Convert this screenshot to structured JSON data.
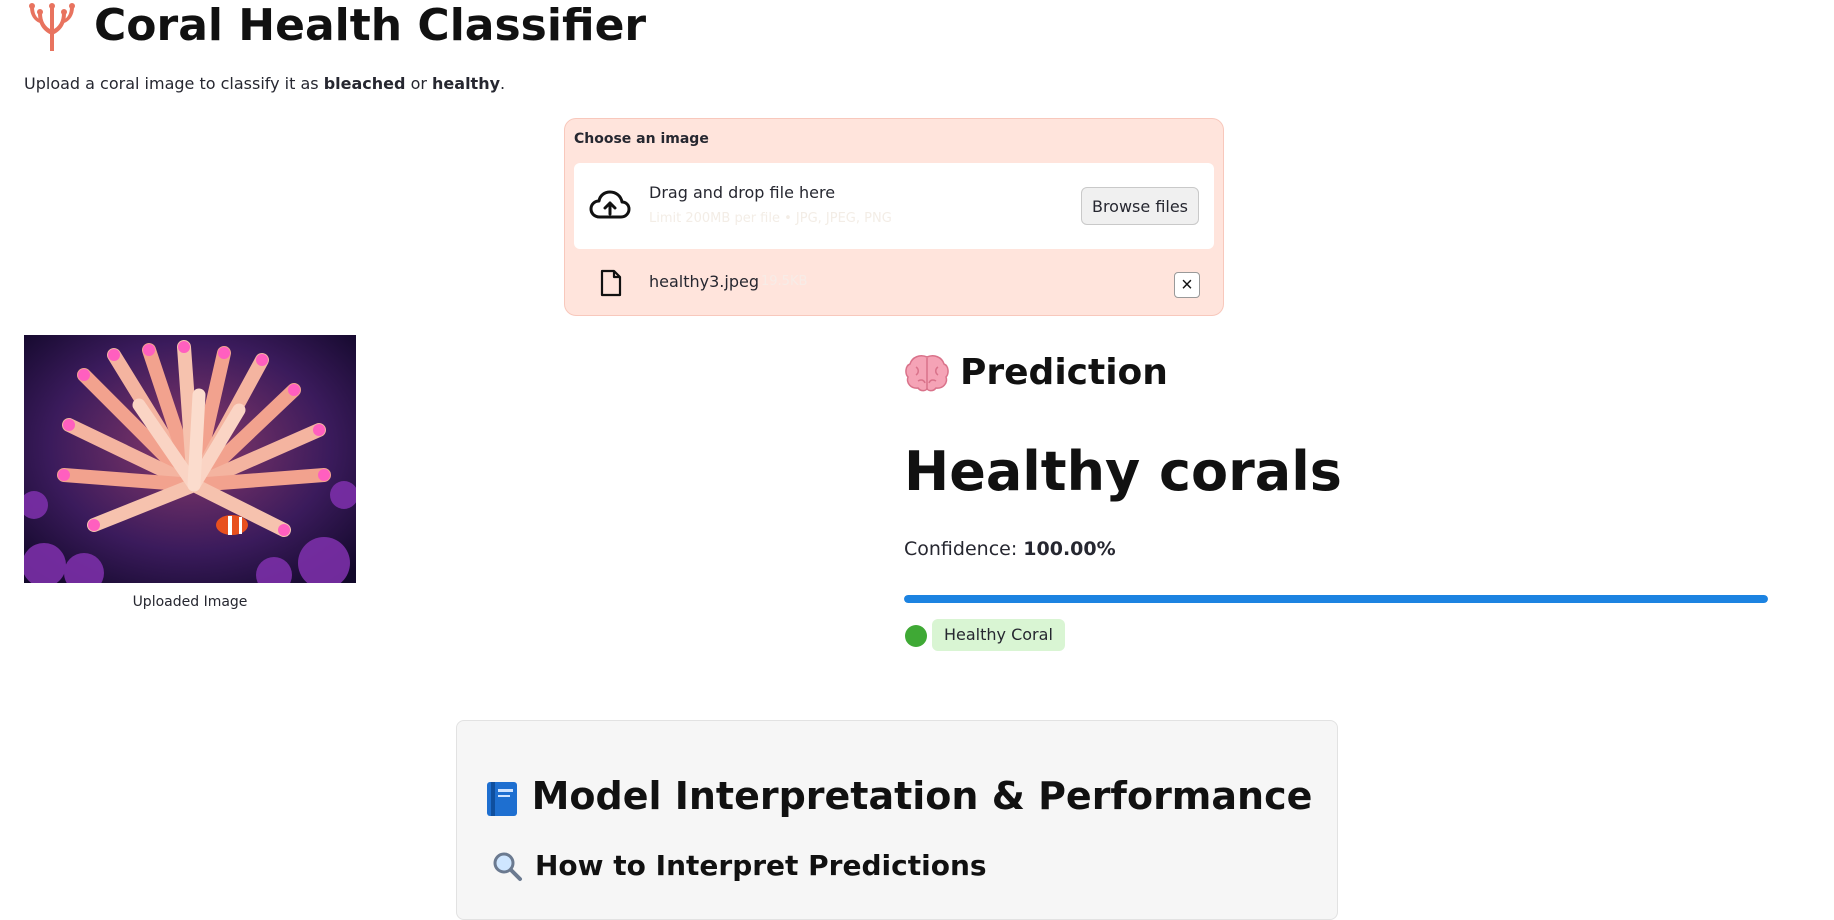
{
  "app": {
    "title": "Coral Health Classifier",
    "subtitle_prefix": "Upload a coral image to classify it as ",
    "subtitle_bleached": "bleached",
    "subtitle_or": " or ",
    "subtitle_healthy": "healthy",
    "subtitle_suffix": "."
  },
  "uploader": {
    "label": "Choose an image",
    "drop_text": "Drag and drop file here",
    "drop_hint": "Limit 200MB per file • JPG, JPEG, PNG",
    "browse_label": "Browse files",
    "file": {
      "name": "healthy3.jpeg",
      "size": "19.5KB"
    }
  },
  "image": {
    "caption": "Uploaded Image"
  },
  "prediction": {
    "header": "Prediction",
    "value": "Healthy corals",
    "confidence_label": "Confidence: ",
    "confidence_value": "100.00%",
    "progress_fraction": 1.0,
    "status_badge": "Healthy Coral"
  },
  "interpretation": {
    "title": "Model Interpretation & Performance",
    "subtitle": "How to Interpret Predictions"
  },
  "icons": [
    "coral-icon",
    "cloud-upload-icon",
    "file-icon",
    "close-icon",
    "brain-icon",
    "green-circle-icon",
    "book-icon",
    "magnifier-icon"
  ],
  "colors": {
    "uploader_bg": "#ffe4dc",
    "progress_fill": "#1c83e1",
    "badge_bg": "#d9f5d3",
    "status_dot": "#3fa935"
  }
}
